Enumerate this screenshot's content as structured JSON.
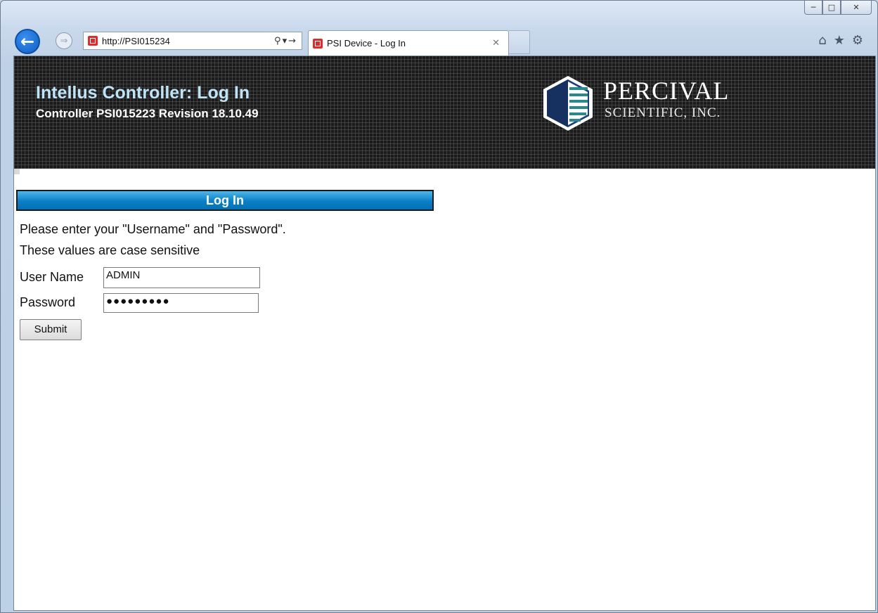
{
  "browser": {
    "address_url": "http://PSI015234",
    "tab_title": "PSI Device - Log In",
    "window_controls": [
      "minimize-icon",
      "restore-icon",
      "close-icon"
    ],
    "toolbar_icons": [
      "home-icon",
      "favorites-star-icon",
      "settings-gear-icon"
    ]
  },
  "banner": {
    "title": "Intellus Controller: Log In",
    "subtitle": "Controller PSI015223 Revision 18.10.49",
    "logo_name": "PERCIVAL",
    "logo_sub": "SCIENTIFIC, INC."
  },
  "login": {
    "section_title": "Log In",
    "instruction": "Please enter your \"Username\" and \"Password\".",
    "note": "These values are case sensitive",
    "username_label": "User Name",
    "username_value": "ADMIN",
    "password_label": "Password",
    "password_mask": "●●●●●●●●●",
    "submit_label": "Submit"
  },
  "colors": {
    "header_text": "#bfe3f7",
    "section_bar": "#0a7fc6",
    "banner_bg": "#1b1b1b"
  }
}
